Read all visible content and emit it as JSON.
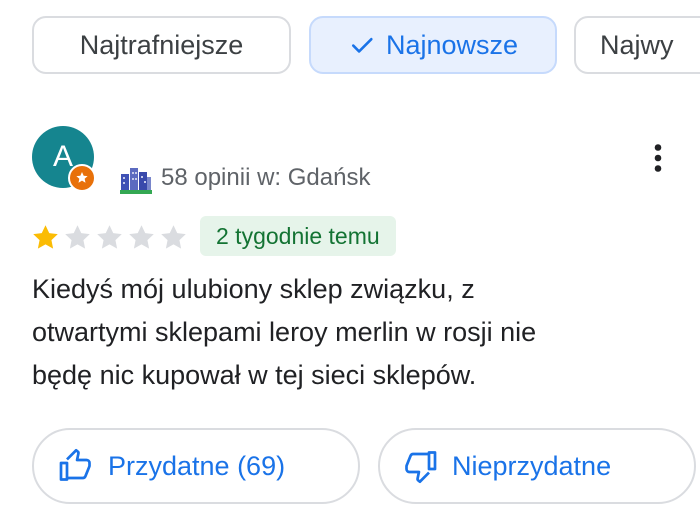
{
  "sort_chips": [
    {
      "label": "Najtrafniejsze",
      "active": false
    },
    {
      "label": "Najnowsze",
      "active": true
    },
    {
      "label": "Najwy",
      "active": false
    }
  ],
  "review": {
    "author_initial": "A",
    "author_stats": "58 opinii w: Gdańsk",
    "rating": 1,
    "rating_max": 5,
    "time_ago": "2 tygodnie temu",
    "text_lines": [
      "Kiedyś mój ulubiony sklep związku,  z",
      "otwartymi sklepami leroy merlin w rosji nie",
      "będę nic kupował w tej sieci sklepów."
    ]
  },
  "actions": {
    "helpful_label": "Przydatne (69)",
    "unhelpful_label": "Nieprzydatne"
  },
  "icons": {
    "check": "check-icon",
    "guide_badge": "local-guide-icon",
    "city": "city-buildings-icon",
    "more": "more-vert-icon",
    "star": "star-icon",
    "thumb_up": "thumb-up-icon",
    "thumb_down": "thumb-down-icon"
  },
  "colors": {
    "accent": "#1a73e8",
    "active_chip_bg": "#e8f0fe",
    "avatar_bg": "#15858f",
    "badge_orange": "#e8710a",
    "star_filled": "#fbbc04",
    "star_empty": "#dadce0",
    "time_badge_bg": "#e6f4ea",
    "time_badge_text": "#137333"
  }
}
